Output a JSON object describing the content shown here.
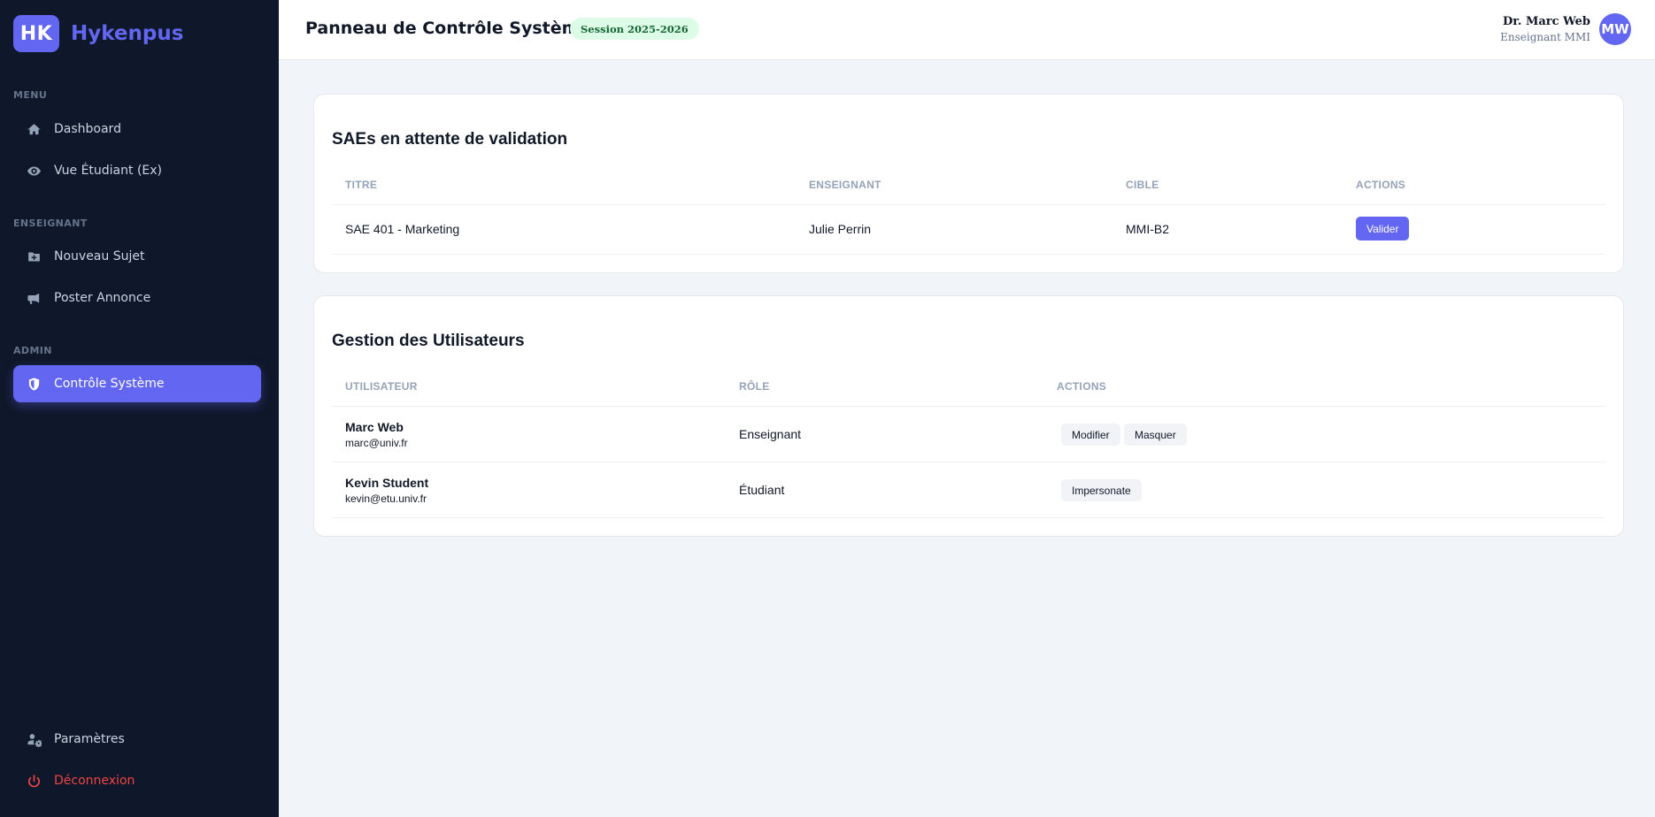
{
  "brand": {
    "logo": "HK",
    "name": "Hykenpus",
    "accent": "#6366f1"
  },
  "sidebar": {
    "sections": {
      "menu": "MENU",
      "teacher": "ENSEIGNANT",
      "admin": "ADMIN"
    },
    "items": [
      {
        "label": "Dashboard",
        "icon": "home-icon"
      },
      {
        "label": "Vue Étudiant (Ex)",
        "icon": "eye-icon"
      },
      {
        "label": "Nouveau Sujet",
        "icon": "folder-plus-icon"
      },
      {
        "label": "Poster Annonce",
        "icon": "megaphone-icon"
      },
      {
        "label": "Contrôle Système",
        "icon": "shield-icon",
        "active": true
      },
      {
        "label": "Paramètres",
        "icon": "user-gear-icon"
      },
      {
        "label": "Déconnexion",
        "icon": "power-icon"
      }
    ]
  },
  "header": {
    "title": "Panneau de Contrôle Système",
    "session": "Session 2025-2026",
    "user": {
      "name": "Dr. Marc Web",
      "role": "Enseignant MMI",
      "initials": "MW"
    }
  },
  "pending": {
    "title": "SAEs en attente de validation",
    "columns": [
      "TITRE",
      "ENSEIGNANT",
      "CIBLE",
      "ACTIONS"
    ],
    "rows": [
      {
        "title": "SAE 401 - Marketing",
        "teacher": "Julie Perrin",
        "target": "MMI-B2",
        "action": "Valider"
      }
    ]
  },
  "users": {
    "title": "Gestion des Utilisateurs",
    "columns": [
      "UTILISATEUR",
      "RÔLE",
      "ACTIONS"
    ],
    "rows": [
      {
        "name": "Marc Web",
        "email": "marc@univ.fr",
        "role": "Enseignant",
        "actions": [
          "Modifier",
          "Masquer"
        ]
      },
      {
        "name": "Kevin Student",
        "email": "kevin@etu.univ.fr",
        "role": "Étudiant",
        "actions": [
          "Impersonate"
        ]
      }
    ]
  }
}
